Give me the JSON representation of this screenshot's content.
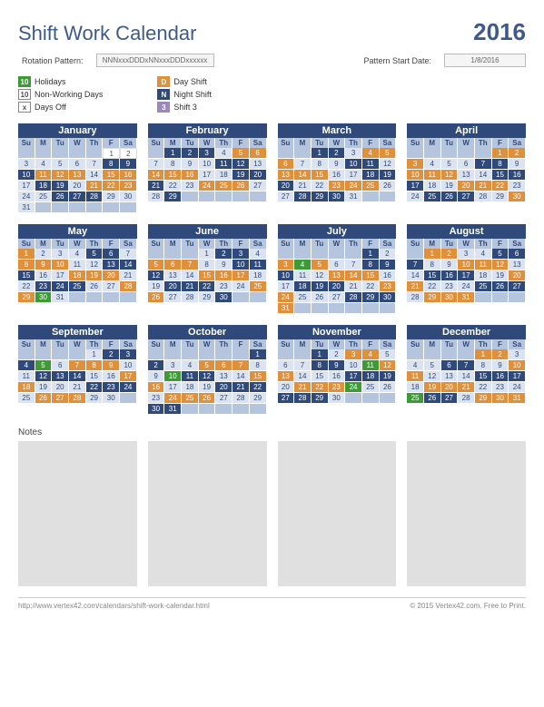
{
  "title": "Shift Work Calendar",
  "year": "2016",
  "controls": {
    "rotation_label": "Rotation Pattern:",
    "rotation_value": "NNNxxxDDDxNNxxxDDDxxxxxx",
    "start_label": "Pattern Start Date:",
    "start_value": "1/8/2016"
  },
  "legend": {
    "left": [
      {
        "swatch": "10",
        "cls": "holiday",
        "label": "Holidays"
      },
      {
        "swatch": "10",
        "cls": "nonwork",
        "label": "Non-Working Days"
      },
      {
        "swatch": "x",
        "cls": "dayoff",
        "label": "Days Off"
      }
    ],
    "right": [
      {
        "swatch": "D",
        "cls": "day",
        "label": "Day Shift"
      },
      {
        "swatch": "N",
        "cls": "night",
        "label": "Night Shift"
      },
      {
        "swatch": "3",
        "cls": "shift3",
        "label": "Shift 3"
      }
    ]
  },
  "dow": [
    "Su",
    "M",
    "Tu",
    "W",
    "Th",
    "F",
    "Sa"
  ],
  "months": [
    {
      "name": "January",
      "start": 5,
      "days": 31,
      "holidays": [],
      "night": [
        8,
        9,
        10,
        18,
        19,
        26,
        27,
        28
      ],
      "day": [
        11,
        12,
        13,
        15,
        16,
        21,
        22,
        23
      ],
      "nonwork": [
        3,
        4,
        5,
        6,
        7,
        14,
        17,
        20,
        24,
        25,
        29,
        30,
        31
      ],
      "off": [
        1,
        2
      ]
    },
    {
      "name": "February",
      "start": 1,
      "days": 29,
      "holidays": [],
      "night": [
        1,
        2,
        3,
        11,
        12,
        19,
        20,
        21,
        29
      ],
      "day": [
        5,
        6,
        14,
        15,
        16,
        24,
        25,
        26
      ],
      "nonwork": [
        4,
        7,
        8,
        9,
        10,
        13,
        17,
        18,
        22,
        23,
        27,
        28
      ],
      "off": []
    },
    {
      "name": "March",
      "start": 2,
      "days": 31,
      "holidays": [],
      "night": [
        1,
        2,
        10,
        11,
        18,
        19,
        20,
        28,
        29,
        30
      ],
      "day": [
        4,
        5,
        6,
        13,
        14,
        15,
        23,
        24,
        25
      ],
      "nonwork": [
        3,
        7,
        8,
        9,
        12,
        16,
        17,
        21,
        22,
        26,
        27,
        31
      ],
      "off": []
    },
    {
      "name": "April",
      "start": 5,
      "days": 30,
      "holidays": [],
      "night": [
        7,
        8,
        15,
        16,
        17,
        25,
        26,
        27
      ],
      "day": [
        1,
        2,
        3,
        10,
        11,
        12,
        20,
        21,
        22,
        30
      ],
      "nonwork": [
        4,
        5,
        6,
        9,
        13,
        14,
        18,
        19,
        23,
        24,
        28,
        29
      ],
      "off": []
    },
    {
      "name": "May",
      "start": 0,
      "days": 31,
      "holidays": [
        30
      ],
      "night": [
        5,
        6,
        13,
        14,
        15,
        23,
        24,
        25
      ],
      "day": [
        1,
        8,
        9,
        10,
        18,
        19,
        20,
        28,
        29
      ],
      "nonwork": [
        2,
        3,
        4,
        7,
        11,
        12,
        16,
        17,
        21,
        22,
        26,
        27,
        31
      ],
      "off": []
    },
    {
      "name": "June",
      "start": 3,
      "days": 30,
      "holidays": [],
      "night": [
        2,
        3,
        10,
        11,
        12,
        20,
        21,
        22,
        30
      ],
      "day": [
        5,
        6,
        7,
        15,
        16,
        17,
        25,
        26
      ],
      "nonwork": [
        1,
        4,
        8,
        9,
        13,
        14,
        18,
        19,
        23,
        24,
        27,
        28,
        29
      ],
      "off": []
    },
    {
      "name": "July",
      "start": 5,
      "days": 31,
      "holidays": [
        4
      ],
      "night": [
        1,
        8,
        9,
        10,
        18,
        19,
        20,
        28,
        29,
        30
      ],
      "day": [
        3,
        5,
        13,
        14,
        15,
        23,
        24,
        31
      ],
      "nonwork": [
        2,
        6,
        7,
        11,
        12,
        16,
        17,
        21,
        22,
        25,
        26,
        27
      ],
      "off": []
    },
    {
      "name": "August",
      "start": 1,
      "days": 31,
      "holidays": [],
      "night": [
        5,
        6,
        7,
        15,
        16,
        17,
        25,
        26,
        27
      ],
      "day": [
        1,
        2,
        10,
        11,
        12,
        20,
        21,
        29,
        30,
        31
      ],
      "nonwork": [
        3,
        4,
        8,
        9,
        13,
        14,
        18,
        19,
        22,
        23,
        24,
        28
      ],
      "off": []
    },
    {
      "name": "September",
      "start": 4,
      "days": 30,
      "holidays": [
        5
      ],
      "night": [
        2,
        3,
        4,
        12,
        13,
        14,
        22,
        23,
        24
      ],
      "day": [
        7,
        8,
        9,
        17,
        18,
        26,
        27,
        28
      ],
      "nonwork": [
        1,
        6,
        10,
        11,
        15,
        16,
        19,
        20,
        21,
        25,
        29,
        30
      ],
      "off": []
    },
    {
      "name": "October",
      "start": 6,
      "days": 31,
      "holidays": [
        10
      ],
      "night": [
        1,
        2,
        11,
        12,
        20,
        21,
        22,
        30,
        31
      ],
      "day": [
        5,
        6,
        7,
        15,
        16,
        24,
        25,
        26
      ],
      "nonwork": [
        3,
        4,
        8,
        9,
        13,
        14,
        17,
        18,
        19,
        23,
        27,
        28,
        29
      ],
      "off": []
    },
    {
      "name": "November",
      "start": 2,
      "days": 30,
      "holidays": [
        11,
        24
      ],
      "night": [
        1,
        8,
        9,
        17,
        18,
        19,
        27,
        28,
        29
      ],
      "day": [
        3,
        4,
        12,
        13,
        21,
        22,
        23
      ],
      "nonwork": [
        2,
        5,
        6,
        7,
        10,
        14,
        15,
        16,
        20,
        25,
        26,
        30
      ],
      "off": []
    },
    {
      "name": "December",
      "start": 4,
      "days": 31,
      "holidays": [
        25
      ],
      "night": [
        6,
        7,
        15,
        16,
        17,
        26,
        27
      ],
      "day": [
        1,
        2,
        10,
        11,
        19,
        20,
        21,
        29,
        30,
        31
      ],
      "nonwork": [
        3,
        4,
        5,
        8,
        9,
        12,
        13,
        14,
        18,
        22,
        23,
        24,
        28
      ],
      "off": []
    }
  ],
  "notes_label": "Notes",
  "footer": {
    "left": "http://www.vertex42.com/calendars/shift-work-calendar.html",
    "right": "© 2015 Vertex42.com. Free to Print."
  }
}
